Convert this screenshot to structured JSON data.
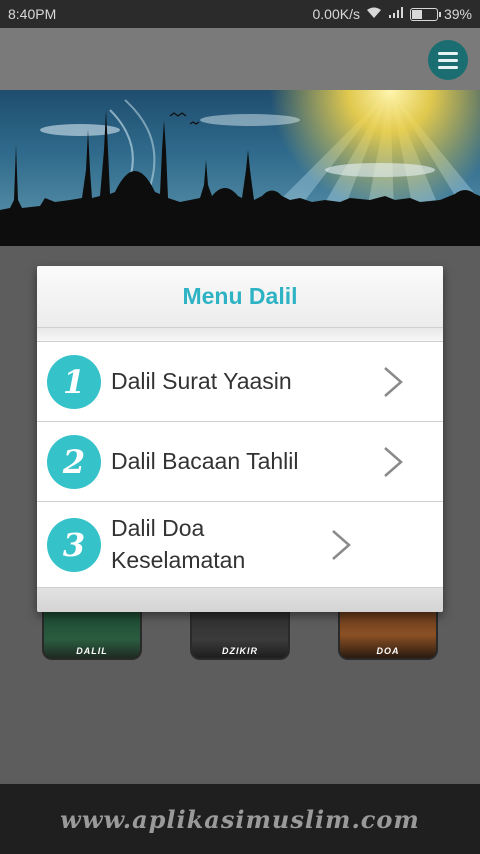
{
  "status_bar": {
    "time": "8:40PM",
    "network_speed": "0.00K/s",
    "battery_percent": "39%",
    "battery_level": 0.39
  },
  "header": {
    "menu_icon": "hamburger-menu-icon"
  },
  "dialog": {
    "title": "Menu Dalil",
    "items": [
      {
        "number": "1",
        "label": "Dalil Surat Yaasin",
        "icon": "chevron-right-icon"
      },
      {
        "number": "2",
        "label": "Dalil Bacaan Tahlil",
        "icon": "chevron-right-icon"
      },
      {
        "number": "3",
        "label": "Dalil Doa Keselamatan",
        "icon": "chevron-right-icon"
      }
    ]
  },
  "tiles": [
    {
      "label": "DALIL"
    },
    {
      "label": "DZIKIR"
    },
    {
      "label": "DOA"
    }
  ],
  "footer": {
    "url": "www.aplikasimuslim.com"
  },
  "colors": {
    "accent": "#35c2c9",
    "title": "#2eb3c4",
    "menu_button": "#1a6e72"
  }
}
